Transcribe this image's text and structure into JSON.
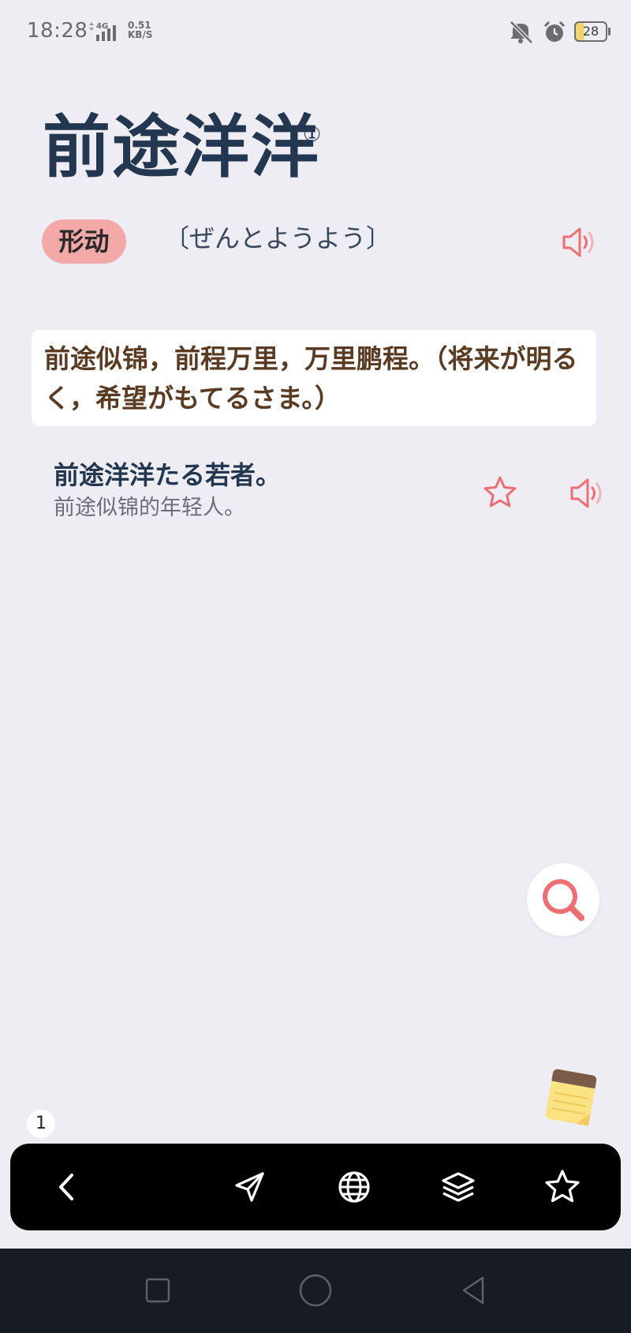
{
  "status_bar": {
    "time": "18:28",
    "network": "4G",
    "speed_value": "0.51",
    "speed_unit": "KB/S",
    "battery": "28"
  },
  "entry": {
    "headword": "前途洋洋",
    "accent_mark": "①",
    "pos": "形动",
    "reading": "〔ぜんとようよう〕",
    "meaning": "前途似锦，前程万里，万里鹏程。（将来が明るく，希望がもてるさま。）"
  },
  "example": {
    "japanese": "前途洋洋たる若者。",
    "chinese": "前途似锦的年轻人。"
  },
  "page_badge": "1",
  "colors": {
    "accent_red": "#ee6f73",
    "headword": "#243750",
    "meaning_text": "#5a3b22",
    "pos_badge": "#f4a9a9",
    "background": "#eeedf4"
  },
  "icons": {
    "toolbar": [
      "back-icon",
      "send-icon",
      "globe-icon",
      "layers-icon",
      "star-icon"
    ],
    "nav": [
      "recent-apps-icon",
      "home-icon",
      "nav-back-icon"
    ]
  }
}
